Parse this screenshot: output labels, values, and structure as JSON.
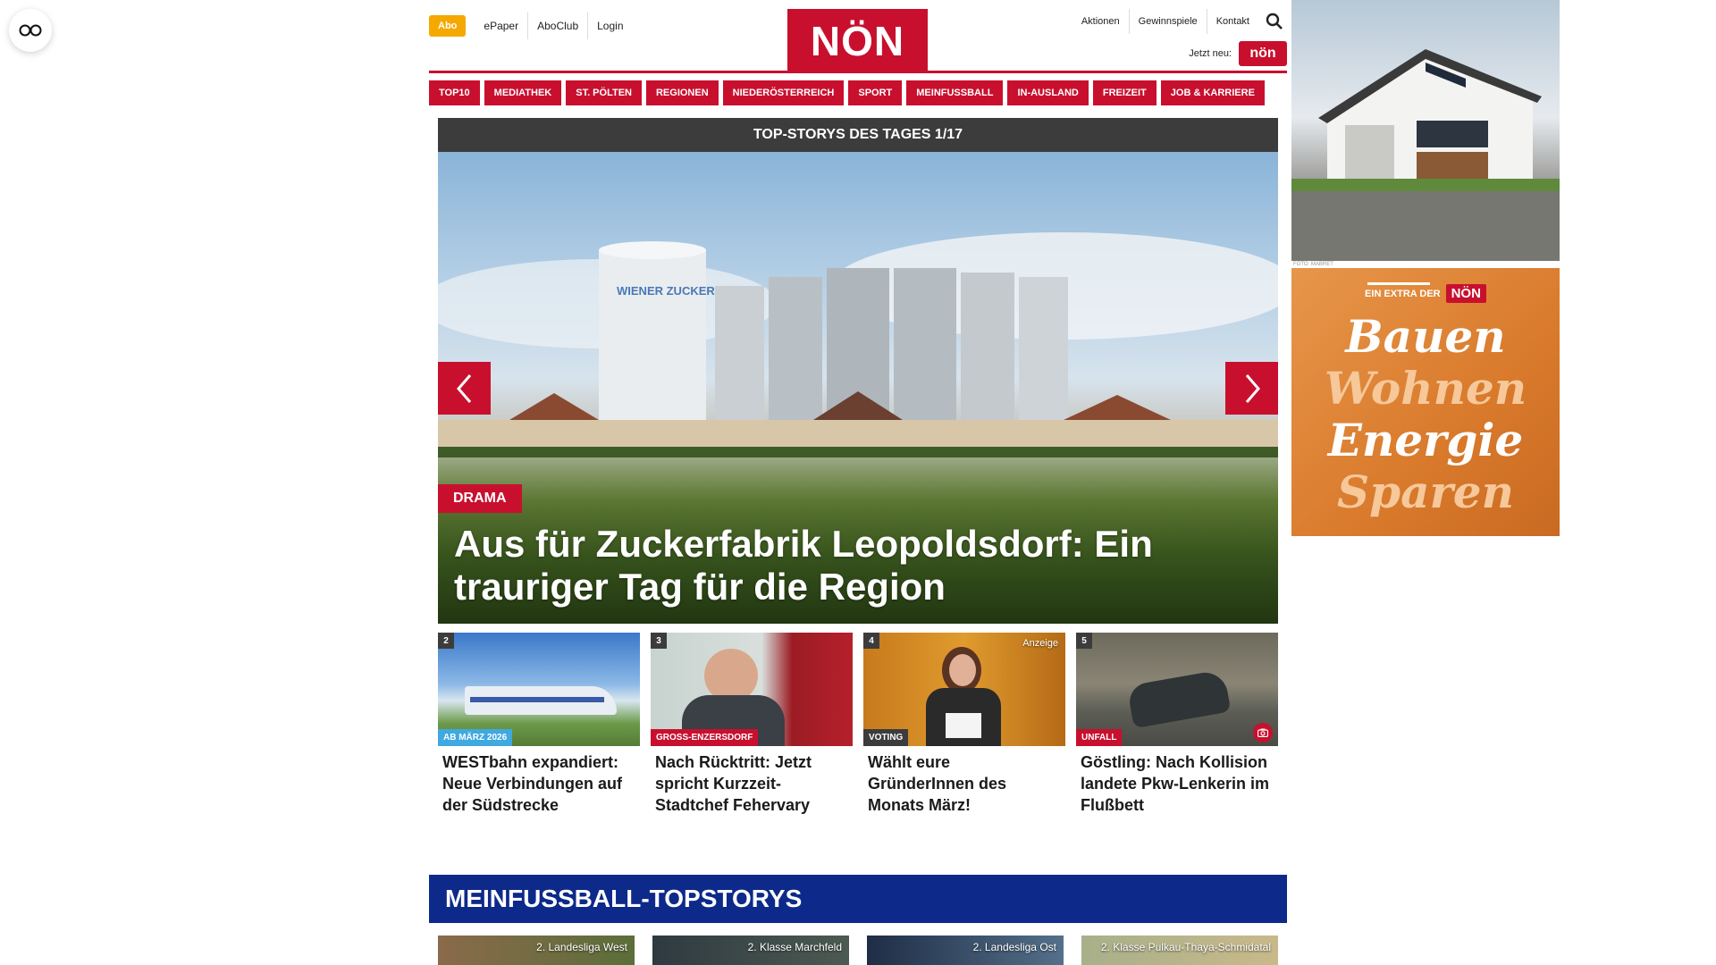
{
  "header": {
    "abo_label": "Abo",
    "links_left": [
      "ePaper",
      "AboClub",
      "Login"
    ],
    "logo_text": "NÖN",
    "links_right": [
      "Aktionen",
      "Gewinnspiele",
      "Kontakt"
    ],
    "jetzt_neu": "Jetzt neu:",
    "jetzt_badge": "nön"
  },
  "nav": [
    "TOP10",
    "MEDIATHEK",
    "ST. PÖLTEN",
    "REGIONEN",
    "NIEDERÖSTERREICH",
    "SPORT",
    "MEINFUSSBALL",
    "IN-AUSLAND",
    "FREIZEIT",
    "JOB & KARRIERE"
  ],
  "topstories": {
    "heading": "TOP-STORYS DES TAGES 1/17",
    "hero": {
      "tag": "DRAMA",
      "title": "Aus für Zuckerfabrik Leopoldsdorf: Ein trauriger Tag für die Region",
      "silo_text": "WIENER ZUCKER"
    },
    "cards": [
      {
        "num": "2",
        "tag": "AB MÄRZ 2026",
        "tag_color": "#3fa9e0",
        "title": "WESTbahn expandiert: Neue Verbindungen auf der Südstrecke",
        "ad": ""
      },
      {
        "num": "3",
        "tag": "GROSS-ENZERSDORF",
        "tag_color": "#c8102e",
        "title": "Nach Rücktritt: Jetzt spricht Kurzzeit-Stadtchef Fehervary",
        "ad": ""
      },
      {
        "num": "4",
        "tag": "VOTING",
        "tag_color": "#3c3c3c",
        "title": "Wählt eure GründerInnen des Monats März!",
        "ad": "Anzeige"
      },
      {
        "num": "5",
        "tag": "UNFALL",
        "tag_color": "#c8102e",
        "title": "Göstling: Nach Kollision landete Pkw-Lenkerin im Flußbett",
        "ad": ""
      }
    ]
  },
  "football": {
    "heading": "MEINFUSSBALL-TOPSTORYS",
    "cards": [
      "2. Landesliga West",
      "2. Klasse Marchfeld",
      "2. Landesliga Ost",
      "2. Klasse Pulkau-Thaya-Schmidatal"
    ]
  },
  "ads": {
    "ad1_credit": "FOTO: MABRET",
    "ad2_head": "EIN EXTRA DER",
    "ad2_logo": "NÖN",
    "ad2_words": [
      "Bauen",
      "Wohnen",
      "Energie",
      "Sparen"
    ]
  },
  "icons": {
    "accessibility": "glasses-icon",
    "search": "search-icon",
    "prev": "chevron-left-icon",
    "next": "chevron-right-icon",
    "camera": "camera-icon"
  },
  "colors": {
    "brand_red": "#c8102e",
    "abo_orange": "#f5a800",
    "dark_bar": "#3c3c3c",
    "football_blue": "#0d2a8a"
  }
}
